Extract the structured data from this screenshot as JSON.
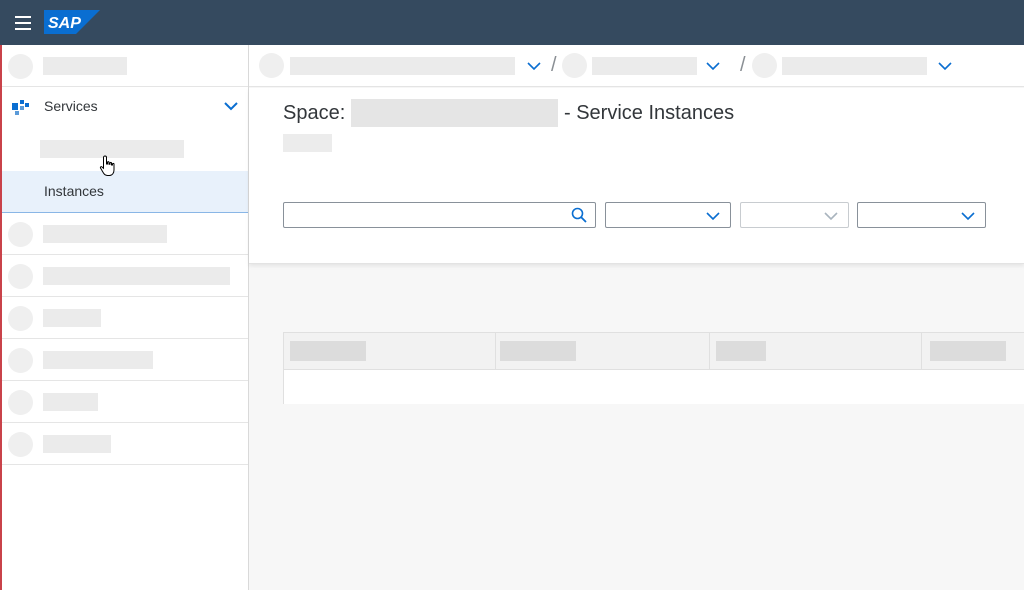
{
  "shell": {
    "logo_text": "SAP",
    "brand_color": "#354a5f",
    "logo_color": "#0a6ed1"
  },
  "sidebar": {
    "services_label": "Services",
    "instances_label": "Instances",
    "selected_item": "Instances",
    "selected_bg": "#e8f1fb"
  },
  "breadcrumb": {
    "separator": "/"
  },
  "page": {
    "title_prefix": "Space:",
    "title_suffix": "- Service Instances"
  },
  "filters": {
    "search_placeholder": "",
    "search_value": ""
  },
  "icons": {
    "menu": "hamburger-menu-icon",
    "services": "services-icon",
    "search": "search-icon",
    "chevron": "chevron-down-icon",
    "cursor": "hand-cursor-icon"
  }
}
